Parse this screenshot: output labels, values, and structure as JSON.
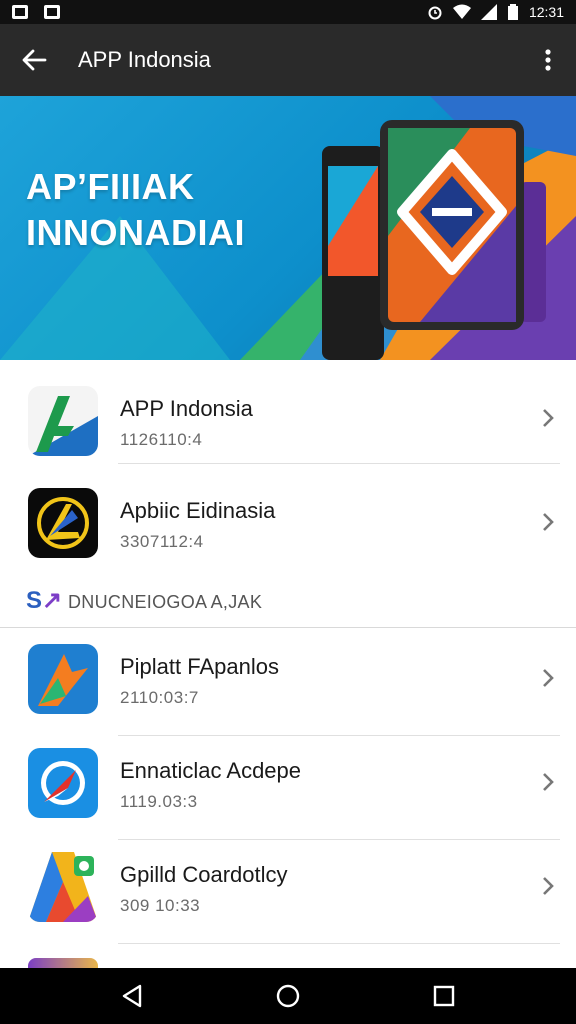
{
  "status_bar": {
    "time": "12:31"
  },
  "app_bar": {
    "title": "APP Indonsia"
  },
  "banner": {
    "line1": "AP’FIIIAK",
    "line2": "INNONADIAI"
  },
  "section": {
    "title": "DNUCNEIOGOA A,JAK",
    "logo": "S"
  },
  "apps": [
    {
      "name": "APP Indonsia",
      "version": "1126110:4"
    },
    {
      "name": "Apbiic Eidinasia",
      "version": "3307112:4"
    },
    {
      "name": "Piplatt FApanlos",
      "version": "2110:03:7"
    },
    {
      "name": "Ennaticlac Acdepe",
      "version": "1119.03:3"
    },
    {
      "name": "Gpilld Coardotlcy",
      "version": "309 10:33"
    }
  ],
  "colors": {
    "app_bar": "#2a2a2a",
    "status_bar": "#111111",
    "banner_blue": "#1ea3d9",
    "divider": "#e0e0e0"
  },
  "icons": [
    "back-arrow-icon",
    "overflow-menu-icon",
    "chevron-right-icon",
    "nav-back-icon",
    "nav-home-icon",
    "nav-recents-icon"
  ]
}
